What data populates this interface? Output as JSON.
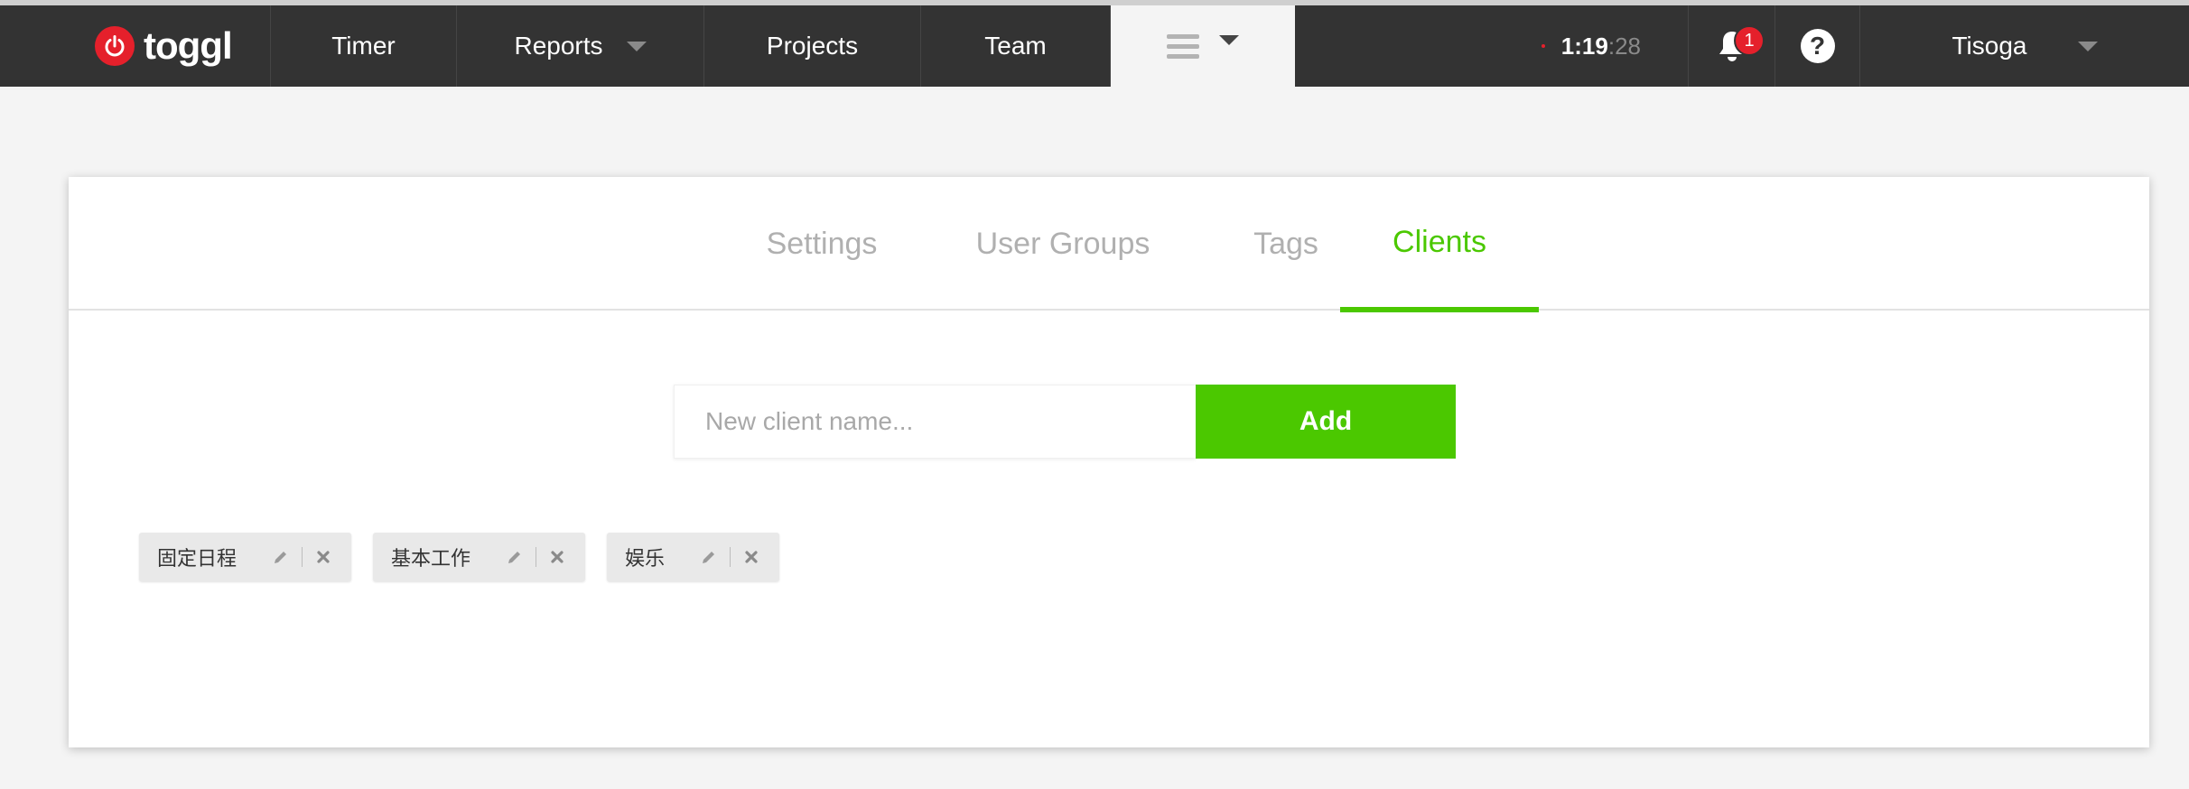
{
  "nav": {
    "logo_text": "toggl",
    "items": [
      {
        "label": "Timer"
      },
      {
        "label": "Reports"
      },
      {
        "label": "Projects"
      },
      {
        "label": "Team"
      }
    ],
    "timer": {
      "main": "1:19",
      "seconds": ":28"
    },
    "notifications_count": "1",
    "help_symbol": "?",
    "user_name": "Tisoga",
    "icons": [
      "power-icon",
      "chevron-down-icon",
      "menu-icon",
      "bell-icon",
      "help-icon"
    ]
  },
  "tabs": [
    {
      "label": "Settings",
      "active": false
    },
    {
      "label": "User Groups",
      "active": false
    },
    {
      "label": "Tags",
      "active": false
    },
    {
      "label": "Clients",
      "active": true
    }
  ],
  "add_client": {
    "placeholder": "New client name...",
    "value": "",
    "button_label": "Add"
  },
  "clients": [
    {
      "name": "固定日程"
    },
    {
      "name": "基本工作"
    },
    {
      "name": "娱乐"
    }
  ],
  "colors": {
    "accent": "#4bc800",
    "brand_red": "#e5202b",
    "nav_bg": "#333333"
  }
}
